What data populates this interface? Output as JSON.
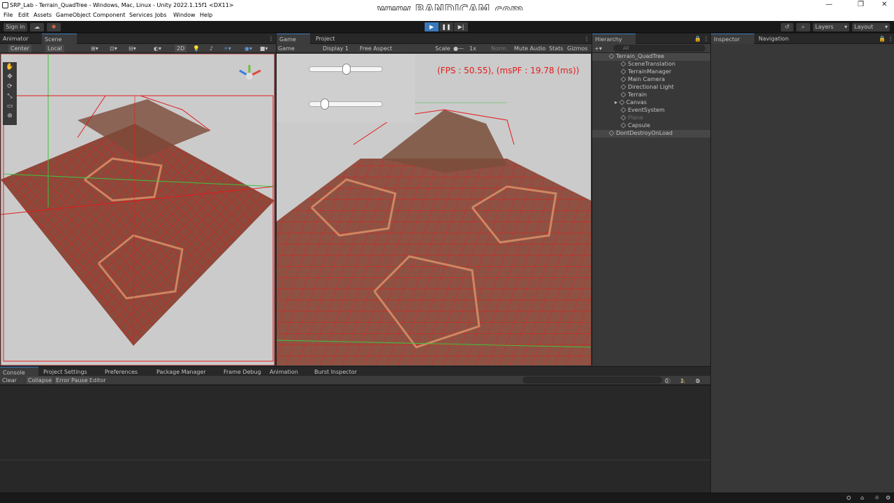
{
  "window": {
    "title": "SRP_Lab - Terrain_QuadTree - Windows, Mac, Linux - Unity 2022.1.15f1 <DX11>",
    "watermark": "www.BANDICAM.com"
  },
  "menu": [
    "File",
    "Edit",
    "Assets",
    "GameObject",
    "Component",
    "Services",
    "Jobs",
    "Window",
    "Help"
  ],
  "toolbar": {
    "signin": "Sign in",
    "layers": "Layers",
    "layout": "Layout"
  },
  "left_tabs": [
    "Animator",
    "Scene"
  ],
  "scene_controls": {
    "pivot": "Center",
    "space": "Local",
    "mode2d": "2D"
  },
  "game_tabs": [
    "Game",
    "Project"
  ],
  "game_controls": {
    "display_type": "Game",
    "display": "Display 1",
    "aspect": "Free Aspect",
    "scale_label": "Scale",
    "scale_value": "1x",
    "norm": "Norm.",
    "mute": "Mute Audio",
    "stats": "Stats",
    "gizmos": "Gizmos"
  },
  "game_overlay": {
    "fps_text": "(FPS : 50.55), (msPF : 19.78 (ms))",
    "slider1_value": 0.5,
    "slider2_value": 0.17
  },
  "hierarchy": {
    "title": "Hierarchy",
    "search_placeholder": "All",
    "scene_root": "Terrain_QuadTree",
    "items": [
      "SceneTranslation",
      "TerrainManager",
      "Main Camera",
      "Directional Light",
      "Terrain",
      "Canvas",
      "EventSystem",
      "Plane",
      "Capsule"
    ],
    "dont_destroy": "DontDestroyOnLoad"
  },
  "inspector_tabs": [
    "Inspector",
    "Navigation"
  ],
  "bottom_tabs": [
    "Console",
    "Project Settings",
    "Preferences",
    "Package Manager",
    "Frame Debug",
    "Animation",
    "Burst Inspector"
  ],
  "console": {
    "clear": "Clear",
    "collapse": "Collapse",
    "error_pause": "Error Pause",
    "editor": "Editor",
    "counts": [
      "0",
      "1",
      "0"
    ]
  },
  "colors": {
    "accent": "#3a79bb",
    "grid": "#e31b1b",
    "fps": "#e31b1b"
  }
}
